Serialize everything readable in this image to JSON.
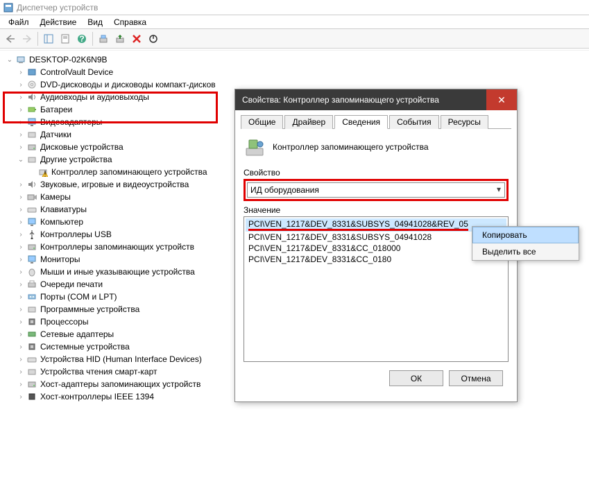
{
  "window": {
    "title": "Диспетчер устройств"
  },
  "menu": {
    "file": "Файл",
    "action": "Действие",
    "view": "Вид",
    "help": "Справка"
  },
  "tree": {
    "root": "DESKTOP-02K6N9B",
    "items": [
      "ControlVault Device",
      "DVD-дисководы и дисководы компакт-дисков",
      "Аудиовходы и аудиовыходы",
      "Батареи",
      "Видеоадаптеры",
      "Датчики",
      "Дисковые устройства",
      "Другие устройства",
      "Звуковые, игровые и видеоустройства",
      "Камеры",
      "Клавиатуры",
      "Компьютер",
      "Контроллеры USB",
      "Контроллеры запоминающих устройств",
      "Мониторы",
      "Мыши и иные указывающие устройства",
      "Очереди печати",
      "Порты (COM и LPT)",
      "Программные устройства",
      "Процессоры",
      "Сетевые адаптеры",
      "Системные устройства",
      "Устройства HID (Human Interface Devices)",
      "Устройства чтения смарт-карт",
      "Хост-адаптеры запоминающих устройств",
      "Хост-контроллеры IEEE 1394"
    ],
    "other_child": "Контроллер запоминающего устройства"
  },
  "dialog": {
    "title": "Свойства: Контроллер запоминающего устройства",
    "tabs": {
      "general": "Общие",
      "driver": "Драйвер",
      "details": "Сведения",
      "events": "События",
      "resources": "Ресурсы"
    },
    "device_name": "Контроллер запоминающего устройства",
    "property_label": "Свойство",
    "property_value": "ИД оборудования",
    "value_label": "Значение",
    "values": [
      "PCI\\VEN_1217&DEV_8331&SUBSYS_04941028&REV_05",
      "PCI\\VEN_1217&DEV_8331&SUBSYS_04941028",
      "PCI\\VEN_1217&DEV_8331&CC_018000",
      "PCI\\VEN_1217&DEV_8331&CC_0180"
    ],
    "ok": "ОК",
    "cancel": "Отмена"
  },
  "context": {
    "copy": "Копировать",
    "select_all": "Выделить все"
  }
}
